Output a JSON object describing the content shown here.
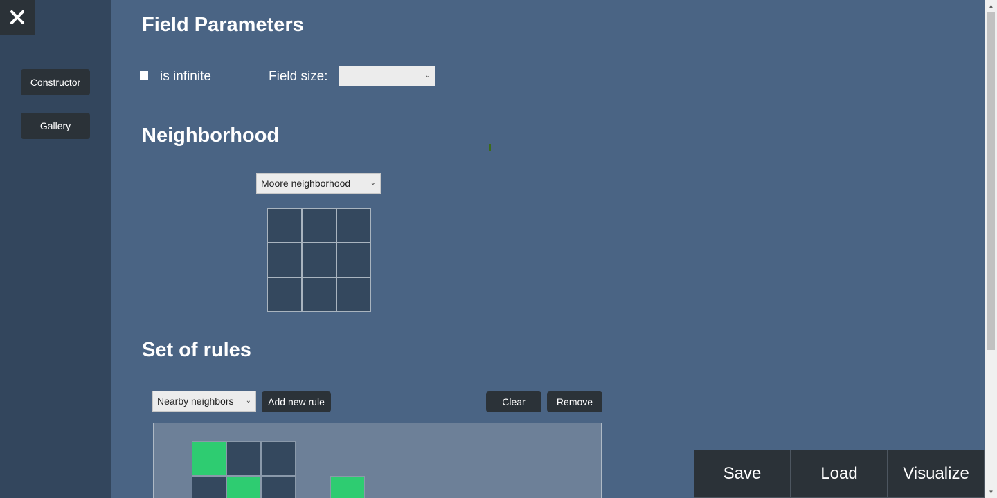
{
  "sidebar": {
    "close_icon": "close-icon",
    "items": [
      {
        "label": "Constructor"
      },
      {
        "label": "Gallery"
      }
    ]
  },
  "field_parameters": {
    "title": "Field Parameters",
    "infinite_label": "is infinite",
    "infinite_checked": false,
    "size_label": "Field size:",
    "size_value": ""
  },
  "neighborhood": {
    "title": "Neighborhood",
    "type_value": "Moore neighborhood"
  },
  "rules": {
    "title": "Set of rules",
    "rule_type_value": "Nearby neighbors",
    "add_label": "Add new rule",
    "clear_label": "Clear",
    "remove_label": "Remove"
  },
  "actions": {
    "save_label": "Save",
    "load_label": "Load",
    "visualize_label": "Visualize"
  },
  "colors": {
    "background": "#4a6484",
    "sidebar": "#33465d",
    "button": "#2b3238",
    "cell_off": "#34485e",
    "cell_on": "#2ecc71"
  }
}
